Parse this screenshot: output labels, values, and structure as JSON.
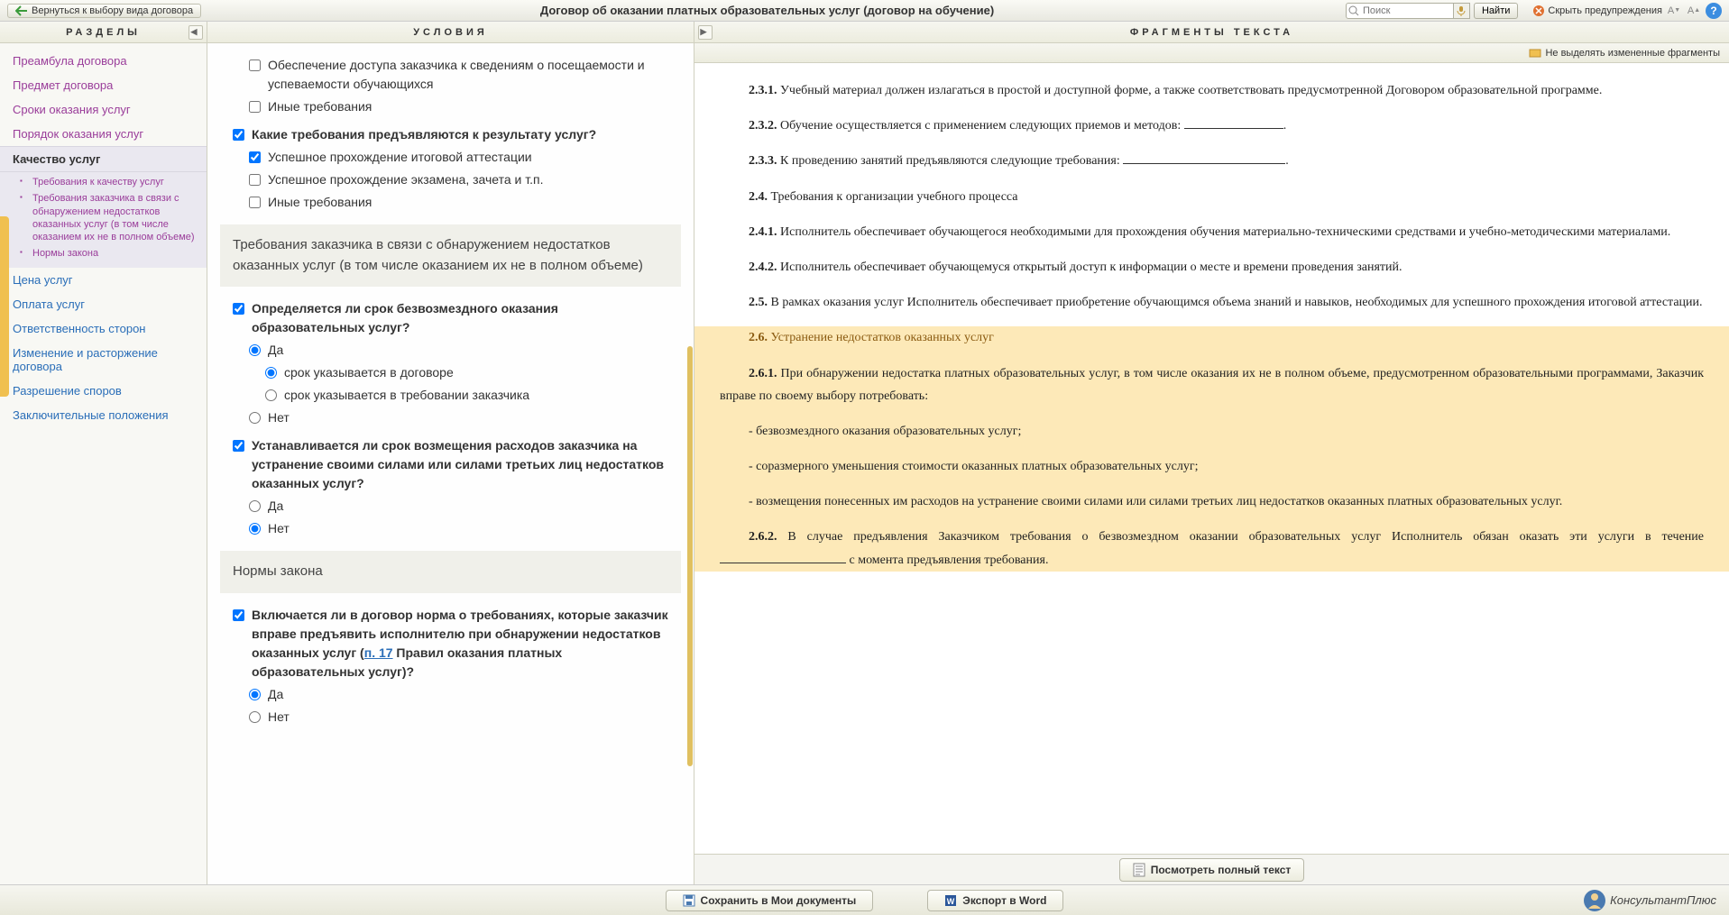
{
  "toolbar": {
    "back": "Вернуться к выбору вида договора",
    "title": "Договор об оказании платных образовательных услуг (договор на обучение)",
    "search_placeholder": "Поиск",
    "find": "Найти",
    "hide_warnings": "Скрыть предупреждения"
  },
  "cols": {
    "sections": "РАЗДЕЛЫ",
    "conditions": "УСЛОВИЯ",
    "fragments": "ФРАГМЕНТЫ ТЕКСТА"
  },
  "nav": {
    "preamble": "Преамбула договора",
    "subject": "Предмет договора",
    "terms": "Сроки оказания услуг",
    "order": "Порядок оказания услуг",
    "quality": "Качество услуг",
    "sub1": "Требования к качеству услуг",
    "sub2": "Требования заказчика в связи с обнаружением недостатков оказанных услуг (в том числе оказанием их не в полном объеме)",
    "sub3": "Нормы закона",
    "price": "Цена услуг",
    "payment": "Оплата услуг",
    "liability": "Ответственность сторон",
    "change": "Изменение и расторжение договора",
    "disputes": "Разрешение споров",
    "final": "Заключительные положения"
  },
  "cond": {
    "cb_access": "Обеспечение доступа заказчика к сведениям о посещаемости и успеваемости обучающихся",
    "cb_other1": "Иные требования",
    "q_result": "Какие требования предъявляются к результату услуг?",
    "cb_atest": "Успешное прохождение итоговой аттестации",
    "cb_exam": "Успешное прохождение экзамена, зачета и т.п.",
    "cb_other2": "Иные требования",
    "h_defects": "Требования заказчика в связи с обнаружением недостатков оказанных услуг (в том числе оказанием их не в полном объеме)",
    "q_free_term": "Определяется ли срок безвозмездного оказания образовательных услуг?",
    "r_yes": "Да",
    "r_in_contract": "срок указывается в договоре",
    "r_in_demand": "срок указывается в требовании заказчика",
    "r_no": "Нет",
    "q_reimb": "Устанавливается ли срок возмещения расходов заказчика на устранение своими силами или силами третьих лиц недостатков оказанных услуг?",
    "h_law": "Нормы закона",
    "q_norm_pre": "Включается ли в договор норма о требованиях, которые заказчик вправе предъявить исполнителю при обнаружении недостатков оказанных услуг (",
    "q_norm_link": "п. 17",
    "q_norm_post": " Правил оказания платных образовательных услуг)?"
  },
  "frag": {
    "no_highlight": "Не выделять измененные фрагменты",
    "p231_n": "2.3.1.",
    "p231": " Учебный материал должен излагаться в простой и доступной форме, а также соответствовать предусмотренной Договором образовательной программе.",
    "p232_n": "2.3.2.",
    "p232": " Обучение осуществляется с применением следующих приемов и методов: ",
    "p233_n": "2.3.3.",
    "p233": " К проведению занятий предъявляются следующие требования: ",
    "p24_n": "2.4.",
    "p24": " Требования к организации учебного процесса",
    "p241_n": "2.4.1.",
    "p241": " Исполнитель обеспечивает обучающегося необходимыми для прохождения обучения материально-техническими средствами и учебно-методическими материалами.",
    "p242_n": "2.4.2.",
    "p242": " Исполнитель обеспечивает обучающемуся открытый доступ к информации о месте и времени проведения занятий.",
    "p25_n": "2.5.",
    "p25": " В рамках оказания услуг Исполнитель обеспечивает приобретение обучающимся объема знаний и навыков, необходимых для успешного прохождения итоговой аттестации.",
    "p26_n": "2.6.",
    "p26": " Устранение недостатков оказанных услуг",
    "p261_n": "2.6.1.",
    "p261": " При обнаружении недостатка платных образовательных услуг, в том числе оказания их не в полном объеме, предусмотренном образовательными программами, Заказчик вправе по своему выбору потребовать:",
    "li1": "- безвозмездного оказания образовательных услуг;",
    "li2": "- соразмерного уменьшения стоимости оказанных платных образовательных услуг;",
    "li3": "- возмещения понесенных им расходов на устранение своими силами или силами третьих лиц недостатков оказанных платных образовательных услуг.",
    "p262_n": "2.6.2.",
    "p262a": " В случае предъявления Заказчиком требования о безвозмездном оказании образовательных услуг Исполнитель обязан оказать эти услуги в течение ",
    "p262b": " с момента предъявления требования.",
    "view_full": "Посмотреть полный текст"
  },
  "footer": {
    "save": "Сохранить в Мои документы",
    "export": "Экспорт в Word",
    "brand": "КонсультантПлюс"
  }
}
